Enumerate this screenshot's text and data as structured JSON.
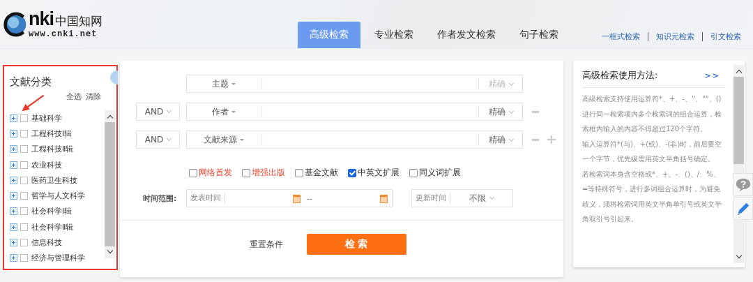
{
  "logo": {
    "brand": "nki",
    "brand_cn": "中国知网",
    "url": "www.cnki.net"
  },
  "tabs": [
    {
      "label": "高级检索",
      "selected": true
    },
    {
      "label": "专业检索",
      "selected": false
    },
    {
      "label": "作者发文检索",
      "selected": false
    },
    {
      "label": "句子检索",
      "selected": false
    }
  ],
  "header_links": [
    "一框式检索",
    "知识元检索",
    "引文检索"
  ],
  "category": {
    "title": "文献分类",
    "select_all": "全选",
    "clear": "清除",
    "items": [
      {
        "label": "基础科学",
        "checked": false
      },
      {
        "label": "工程科技Ⅰ辑",
        "checked": false
      },
      {
        "label": "工程科技Ⅱ辑",
        "checked": false
      },
      {
        "label": "农业科技",
        "checked": false
      },
      {
        "label": "医药卫生科技",
        "checked": false
      },
      {
        "label": "哲学与人文科学",
        "checked": false
      },
      {
        "label": "社会科学Ⅰ辑",
        "checked": false
      },
      {
        "label": "社会科学Ⅱ辑",
        "checked": false
      },
      {
        "label": "信息科技",
        "checked": false
      },
      {
        "label": "经济与管理科学",
        "checked": false
      }
    ]
  },
  "search_rows": [
    {
      "field": "主题",
      "match": "精确",
      "match_disabled": true,
      "removable": false,
      "addable": false
    },
    {
      "logic": "AND",
      "field": "作者",
      "match": "精确",
      "match_disabled": false,
      "removable": true,
      "addable": false
    },
    {
      "logic": "AND",
      "field": "文献来源",
      "match": "精确",
      "match_disabled": false,
      "removable": true,
      "addable": true
    }
  ],
  "options": [
    {
      "label": "网络首发",
      "checked": false,
      "highlighted": true
    },
    {
      "label": "增强出版",
      "checked": false,
      "highlighted": true
    },
    {
      "label": "基金文献",
      "checked": false,
      "highlighted": false
    },
    {
      "label": "中英文扩展",
      "checked": true,
      "highlighted": false
    },
    {
      "label": "同义词扩展",
      "checked": false,
      "highlighted": false
    }
  ],
  "time_range": {
    "label": "时间范围:",
    "publish_label": "发表时间",
    "separator": "--",
    "update_label": "更新时间",
    "update_value": "不限"
  },
  "buttons": {
    "reset": "重置条件",
    "search": "检 索"
  },
  "help": {
    "title": "高级检索使用方法:",
    "more": ">>",
    "paragraphs": [
      "高级检索支持使用运算符*、+、-、''、\"\"、()进行同一检索项内多个检索词的组合运算，检索框内输入的内容不得超过120个字符。",
      "输入运算符*(与)、+(或)、-(非)时，前后要空一个字节，优先级需用英文半角括号确定。",
      "若检索词本身含空格或*、+、-、()、/、%、=等特殊符号，进行多词组合运算时，为避免歧义，须将检索词用英文半角单引号或英文半角双引号引起来。"
    ]
  }
}
